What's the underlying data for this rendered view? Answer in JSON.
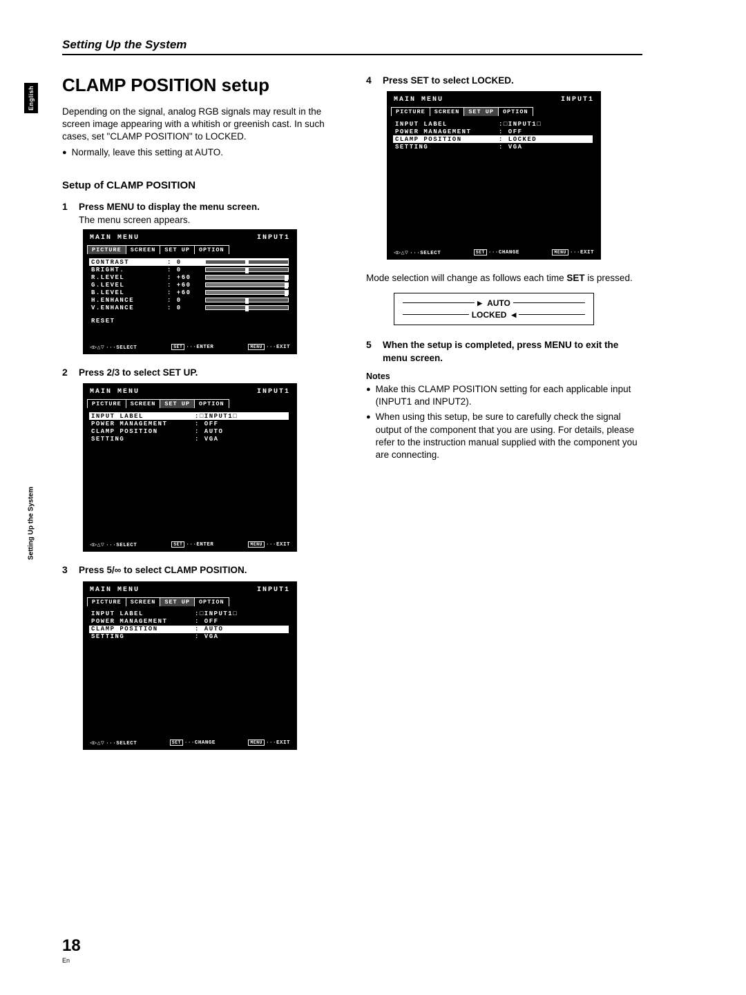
{
  "sideTabs": {
    "language": "English",
    "section": "Setting Up the System"
  },
  "header": {
    "title": "Setting Up the System"
  },
  "left": {
    "h1": "CLAMP POSITION setup",
    "intro": "Depending on the signal, analog RGB signals may result in the screen image appearing with a whitish or greenish cast. In such cases, set \"CLAMP POSITION\" to LOCKED.",
    "introBullet": "Normally, leave this setting at AUTO.",
    "h2": "Setup of CLAMP POSITION",
    "step1": {
      "n": "1",
      "title": "Press MENU to display the menu screen.",
      "sub": "The menu screen appears."
    },
    "step2": {
      "n": "2",
      "title": "Press 2/3 to select SET UP."
    },
    "step3": {
      "n": "3",
      "title": "Press 5/∞ to select CLAMP POSITION."
    }
  },
  "right": {
    "step4": {
      "n": "4",
      "title": "Press SET to select LOCKED."
    },
    "modeLead": "Mode selection will change as follows each time ",
    "modeLeadB": "SET",
    "modeLeadTail": " is pressed.",
    "modeA": "AUTO",
    "modeB": "LOCKED",
    "step5": {
      "n": "5",
      "title": "When the setup is completed, press MENU to exit the menu screen."
    },
    "notesH": "Notes",
    "note1": "Make this CLAMP POSITION setting for each applicable input (INPUT1 and INPUT2).",
    "note2": "When using this setup, be sure to carefully check the signal output of the component that you are using. For details, please refer to the instruction manual supplied with the component you are connecting."
  },
  "osd": {
    "title": "MAIN MENU",
    "input": "INPUT1",
    "tabs": {
      "picture": "PICTURE",
      "screen": "SCREEN",
      "setup": "SET UP",
      "option": "OPTION"
    },
    "picture": {
      "contrast": {
        "lab": "CONTRAST",
        "val": ":    0"
      },
      "bright": {
        "lab": "BRIGHT.",
        "val": ":    0"
      },
      "rlevel": {
        "lab": "R.LEVEL",
        "val": ": +60"
      },
      "glevel": {
        "lab": "G.LEVEL",
        "val": ": +60"
      },
      "blevel": {
        "lab": "B.LEVEL",
        "val": ": +60"
      },
      "henh": {
        "lab": "H.ENHANCE",
        "val": ":    0"
      },
      "venh": {
        "lab": "V.ENHANCE",
        "val": ":    0"
      },
      "reset": "RESET"
    },
    "setup": {
      "inputlabel": {
        "lab": "INPUT LABEL",
        "val": ":□INPUT1□"
      },
      "powermgmt": {
        "lab": "POWER MANAGEMENT",
        "val": ": OFF"
      },
      "clampAuto": {
        "lab": "CLAMP POSITION",
        "val": ": AUTO"
      },
      "clampLock": {
        "lab": "CLAMP POSITION",
        "val": ": LOCKED"
      },
      "setting": {
        "lab": "SETTING",
        "val": ": VGA"
      }
    },
    "footer": {
      "select": "SELECT",
      "enter": "ENTER",
      "change": "CHANGE",
      "exit": "EXIT",
      "set": "SET",
      "menu": "MENU"
    }
  },
  "pageNumber": "18",
  "pageLang": "En"
}
